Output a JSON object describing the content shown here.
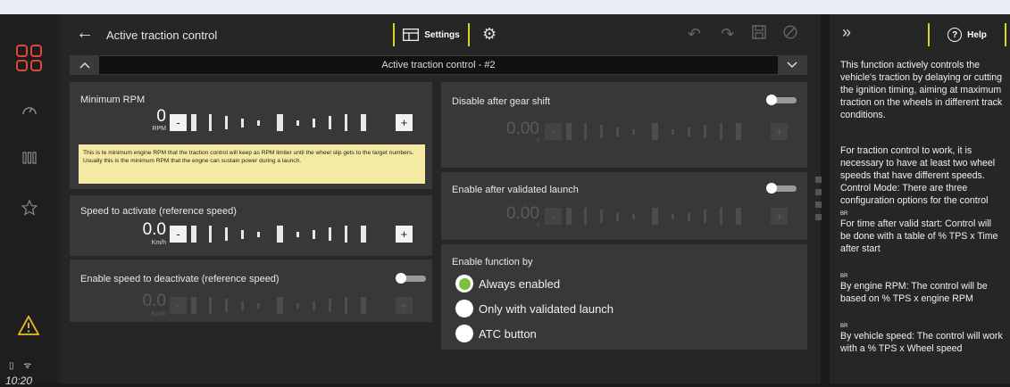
{
  "rail": {
    "icons": [
      "logo-icon",
      "dashboard-icon",
      "gauges-icon",
      "favorites-icon",
      "warning-icon"
    ],
    "status_icons": "▯ ᯤ",
    "clock": "10:20"
  },
  "header": {
    "back_icon": "←",
    "title": "Active traction control",
    "settings_label": "Settings",
    "gear_icon": "⚙",
    "undo_icon": "↶",
    "redo_icon": "↷",
    "save_icon": "🖫",
    "cancel_icon": "⊘"
  },
  "selector": {
    "label": "Active traction control - #2",
    "up_icon": "︿",
    "down_icon": "﹀"
  },
  "cards": {
    "min_rpm": {
      "label": "Minimum RPM",
      "value": "0",
      "unit": "RPM",
      "minus": "-",
      "plus": "+",
      "note": "This is te minimum engine RPM that the traction control will keep as RPM limiter until the wheel slip gets to the target numbers. Usually this is the minimum RPM that the engne can sustain power during a launch."
    },
    "speed_activate": {
      "label": "Speed to activate (reference speed)",
      "value": "0.0",
      "unit": "Km/h",
      "minus": "-",
      "plus": "+"
    },
    "speed_deactivate": {
      "label": "Enable speed to deactivate (reference speed)",
      "value": "0.0",
      "unit": "Km/h",
      "minus": "-",
      "plus": "+",
      "enabled": false
    },
    "disable_gear": {
      "label": "Disable after gear shift",
      "value": "0.00",
      "unit": "s",
      "minus": "-",
      "plus": "+",
      "enabled": false
    },
    "enable_launch": {
      "label": "Enable after validated launch",
      "value": "0.00",
      "unit": "s",
      "minus": "-",
      "plus": "+",
      "enabled": false
    },
    "enable_by": {
      "label": "Enable function by",
      "options": [
        "Always enabled",
        "Only with validated launch",
        "ATC button"
      ],
      "selected": "Always enabled"
    }
  },
  "help": {
    "collapse_icon": "»",
    "tab_label": "Help",
    "q_icon": "?",
    "p1": "This function actively controls the vehicle's traction by delaying or cutting the ignition timing, aiming at maximum traction on the wheels in different track conditions.",
    "p2": "For traction control to work, it is necessary to have at least two wheel speeds that have different speeds. Control Mode: There are three configuration options for the control",
    "br": "BR",
    "p3": "For time after valid start: Control will be done with a table of % TPS x Time after start",
    "p4": "By engine RPM: The control will be based on % TPS x engine RPM",
    "p5": "By vehicle speed: The control will work with a % TPS x Wheel speed"
  },
  "colors": {
    "accent_yellow": "#d9d61f",
    "logo_red": "#e0473a",
    "radio_green": "#7fbf3f",
    "note_bg": "#f5eaa3"
  }
}
